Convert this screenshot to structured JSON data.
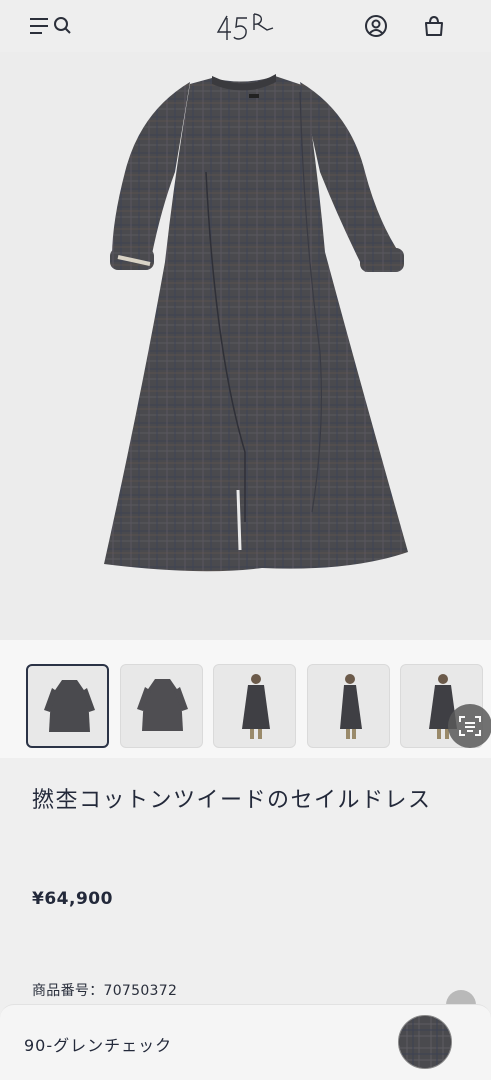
{
  "header": {
    "menu_icon": "hamburger-menu-icon",
    "search_icon": "search-icon",
    "logo_text": "45R",
    "account_icon": "account-icon",
    "cart_icon": "shopping-bag-icon"
  },
  "product": {
    "title": "撚杢コットンツイードのセイルドレス",
    "price": "¥64,900",
    "sku": "商品番号：70750372",
    "color_name": "90-グレンチェック"
  },
  "thumbnails": [
    {
      "name": "dress-front",
      "active": true
    },
    {
      "name": "dress-back",
      "active": false
    },
    {
      "name": "model-front",
      "active": false
    },
    {
      "name": "model-side",
      "active": false
    },
    {
      "name": "model-front-2",
      "active": false
    }
  ],
  "colors": {
    "fabric": "#4a4a4e",
    "accent_navy": "#2b3346",
    "background": "#efefef"
  }
}
